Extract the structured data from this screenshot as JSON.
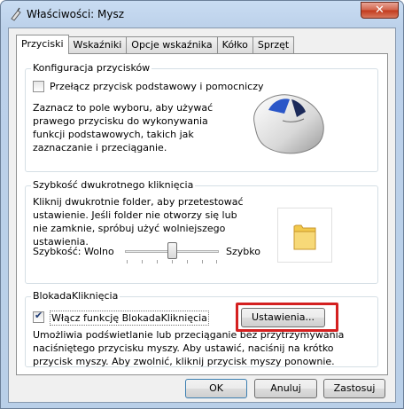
{
  "window": {
    "title": "Właściwości: Mysz",
    "close_glyph": "✕"
  },
  "tabs": [
    {
      "label": "Przyciski",
      "active": true
    },
    {
      "label": "Wskaźniki"
    },
    {
      "label": "Opcje wskaźnika"
    },
    {
      "label": "Kółko"
    },
    {
      "label": "Sprzęt"
    }
  ],
  "config": {
    "title": "Konfiguracja przycisków",
    "switch_label": "Przełącz przycisk podstawowy i pomocniczy",
    "switch_checked": false,
    "description": "Zaznacz to pole wyboru, aby używać prawego przycisku do wykonywania funkcji podstawowych, takich jak zaznaczanie i przeciąganie."
  },
  "doubleclick": {
    "title": "Szybkość dwukrotnego kliknięcia",
    "description": "Kliknij dwukrotnie folder, aby przetestować ustawienie. Jeśli folder nie otworzy się lub nie zamknie, spróbuj użyć wolniejszego ustawienia.",
    "speed_label": "Szybkość:",
    "slow_label": "Wolno",
    "fast_label": "Szybko",
    "speed_value": 0.5
  },
  "clicklock": {
    "title": "BlokadaKliknięcia",
    "enable_label": "Włącz funkcję BlokadaKliknięcia",
    "enable_checked": true,
    "settings_button": "Ustawienia...",
    "description": "Umożliwia podświetlanie lub przeciąganie bez przytrzymywania naciśniętego przycisku myszy. Aby ustawić, naciśnij na krótko przycisk myszy. Aby zwolnić, kliknij przycisk myszy ponownie."
  },
  "footer": {
    "ok": "OK",
    "cancel": "Anuluj",
    "apply": "Zastosuj"
  },
  "colors": {
    "highlight": "#d42020",
    "folder": "#f2c94c"
  }
}
